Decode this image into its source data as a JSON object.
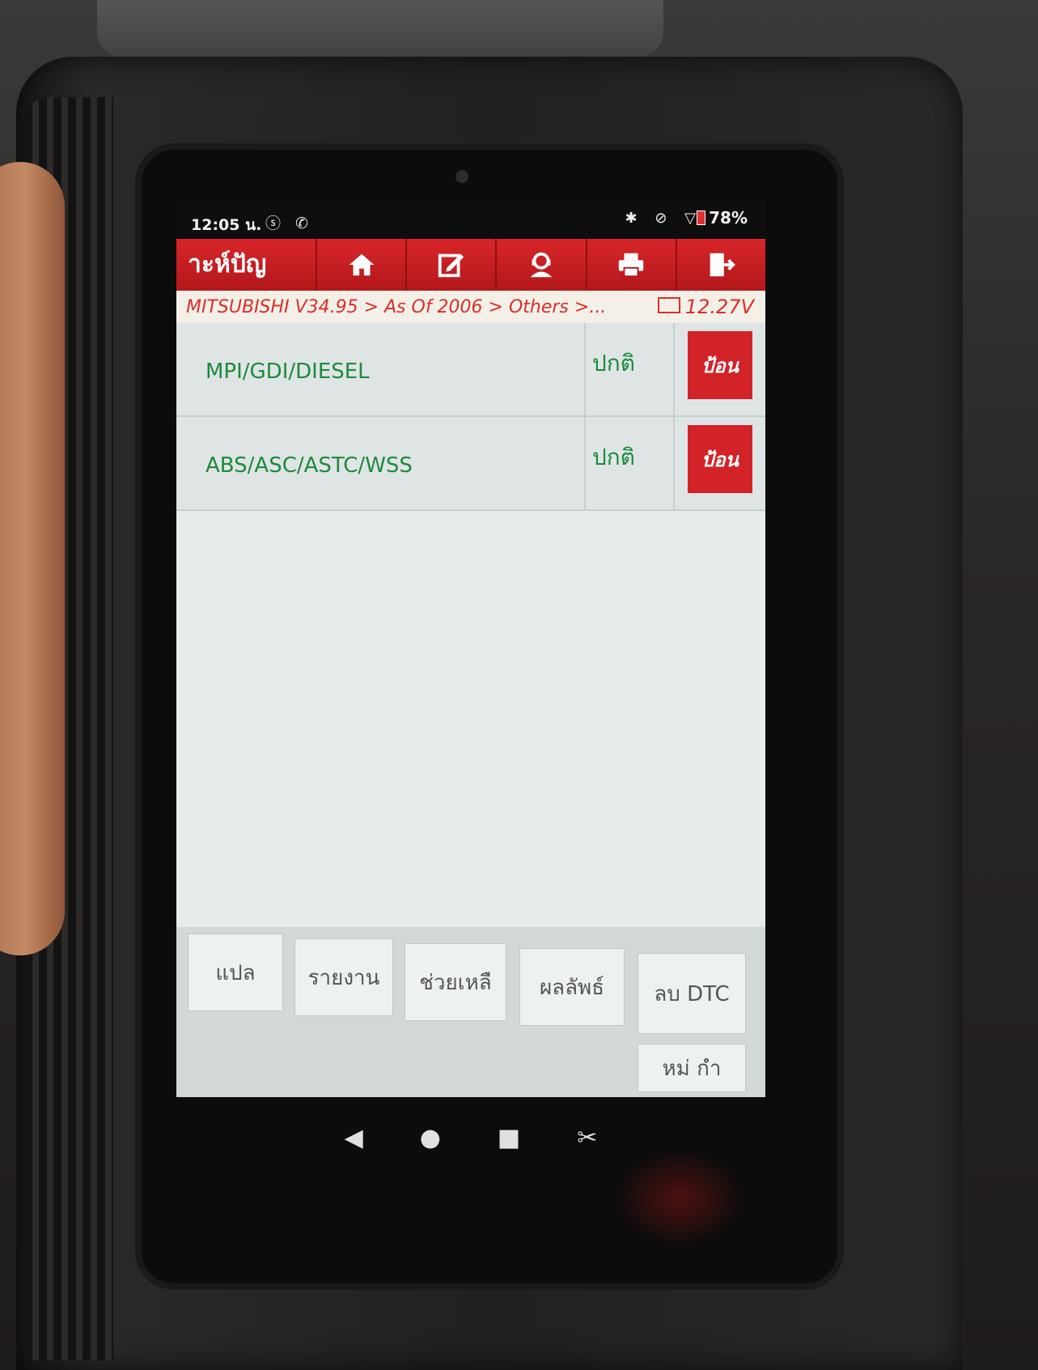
{
  "status_bar": {
    "time": "12:05 น.",
    "left_icons": "ⓢ ✆",
    "right_icons": "✱ ⊘ ▽",
    "battery": "78%"
  },
  "toolbar": {
    "title": "าะห์ปัญ",
    "buttons": [
      {
        "name": "home",
        "icon": "home-icon"
      },
      {
        "name": "edit",
        "icon": "edit-icon"
      },
      {
        "name": "support",
        "icon": "user-support-icon"
      },
      {
        "name": "print",
        "icon": "printer-icon"
      },
      {
        "name": "exit",
        "icon": "exit-icon"
      }
    ]
  },
  "breadcrumb": {
    "path": "MITSUBISHI V34.95 > As Of 2006 > Others >...",
    "voltage": "12.27V"
  },
  "systems": [
    {
      "name": "MPI/GDI/DIESEL",
      "status": "ปกติ",
      "action": "ป้อน"
    },
    {
      "name": "ABS/ASC/ASTC/WSS",
      "status": "ปกติ",
      "action": "ป้อน"
    }
  ],
  "actions": {
    "translate": "แปล",
    "report": "รายงาน",
    "help": "ช่วยเหลื",
    "result": "ผลลัพธ์",
    "clear_dtc": "ลบ DTC",
    "more": "หม่     กำ"
  },
  "colors": {
    "toolbar_red": "#c81e22",
    "system_green": "#1e8a3a",
    "breadcrumb_red": "#d7302b"
  }
}
